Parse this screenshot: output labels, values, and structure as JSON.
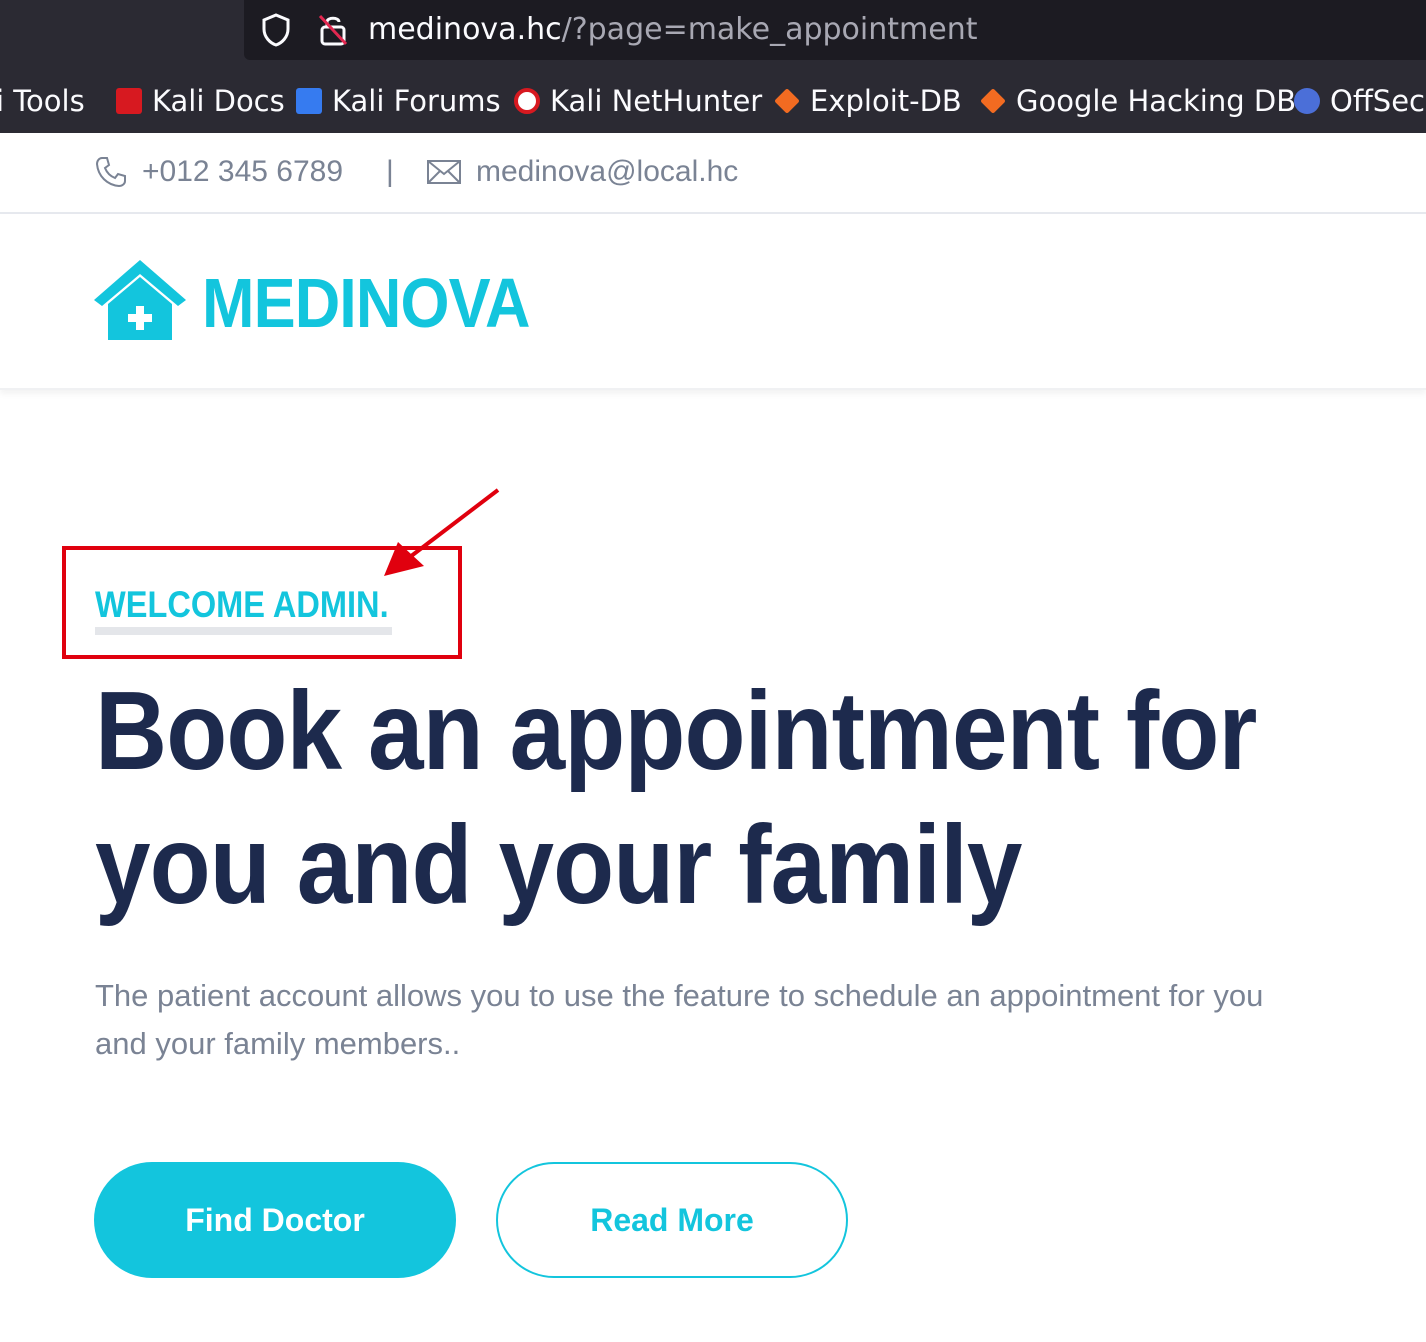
{
  "browser": {
    "url_host": "medinova.hc",
    "url_path": "/?page=make_appointment",
    "bookmarks": [
      {
        "label": "i Tools",
        "icon": "kali-tools-icon",
        "color": "#2b2a33"
      },
      {
        "label": "Kali Docs",
        "icon": "kali-docs-icon",
        "color": "#d71920"
      },
      {
        "label": "Kali Forums",
        "icon": "kali-forums-icon",
        "color": "#367bf0"
      },
      {
        "label": "Kali NetHunter",
        "icon": "kali-nethunter-icon",
        "color": "#d71920"
      },
      {
        "label": "Exploit-DB",
        "icon": "exploit-db-icon",
        "color": "#f26b21"
      },
      {
        "label": "Google Hacking DB",
        "icon": "ghdb-icon",
        "color": "#f26b21"
      },
      {
        "label": "OffSec",
        "icon": "offsec-icon",
        "color": "#4b6fd8"
      }
    ]
  },
  "topbar": {
    "phone": "+012 345 6789",
    "separator": "|",
    "email": "medinova@local.hc"
  },
  "brand": {
    "name": "MEDINOVA",
    "accent": "#13c5dd",
    "dark": "#1d2a4d"
  },
  "hero": {
    "welcome": "WELCOME ADMIN.",
    "headline_line1": "Book an appointment for",
    "headline_line2": "you and your family",
    "lead_line1": "The patient account allows you to use the feature to schedule an appointment for you",
    "lead_line2": "and your family members..",
    "primary_button": "Find Doctor",
    "secondary_button": "Read More"
  },
  "annotation": {
    "color": "#e0000e"
  }
}
